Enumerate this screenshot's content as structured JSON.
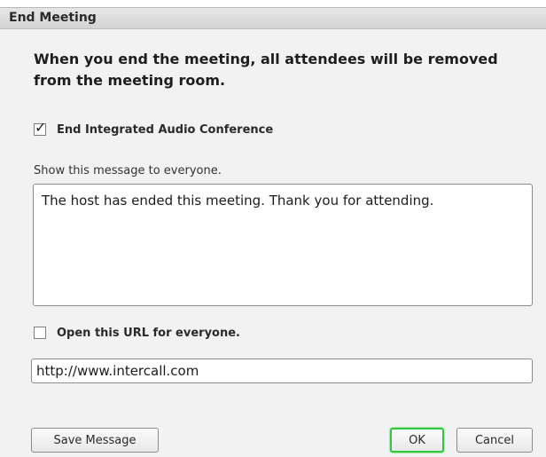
{
  "dialog": {
    "title": "End Meeting",
    "heading": "When you end the meeting, all attendees will be removed from the meeting room."
  },
  "options": {
    "end_audio": {
      "label": "End Integrated Audio Conference",
      "checked": true
    },
    "message": {
      "label": "Show this message to everyone.",
      "value": "The host has ended this meeting. Thank you for attending."
    },
    "open_url": {
      "label": "Open this URL for everyone.",
      "checked": false,
      "value": "http://www.intercall.com"
    }
  },
  "buttons": {
    "save_message": "Save Message",
    "ok": "OK",
    "cancel": "Cancel"
  },
  "colors": {
    "focus_ring": "#2ec940"
  }
}
